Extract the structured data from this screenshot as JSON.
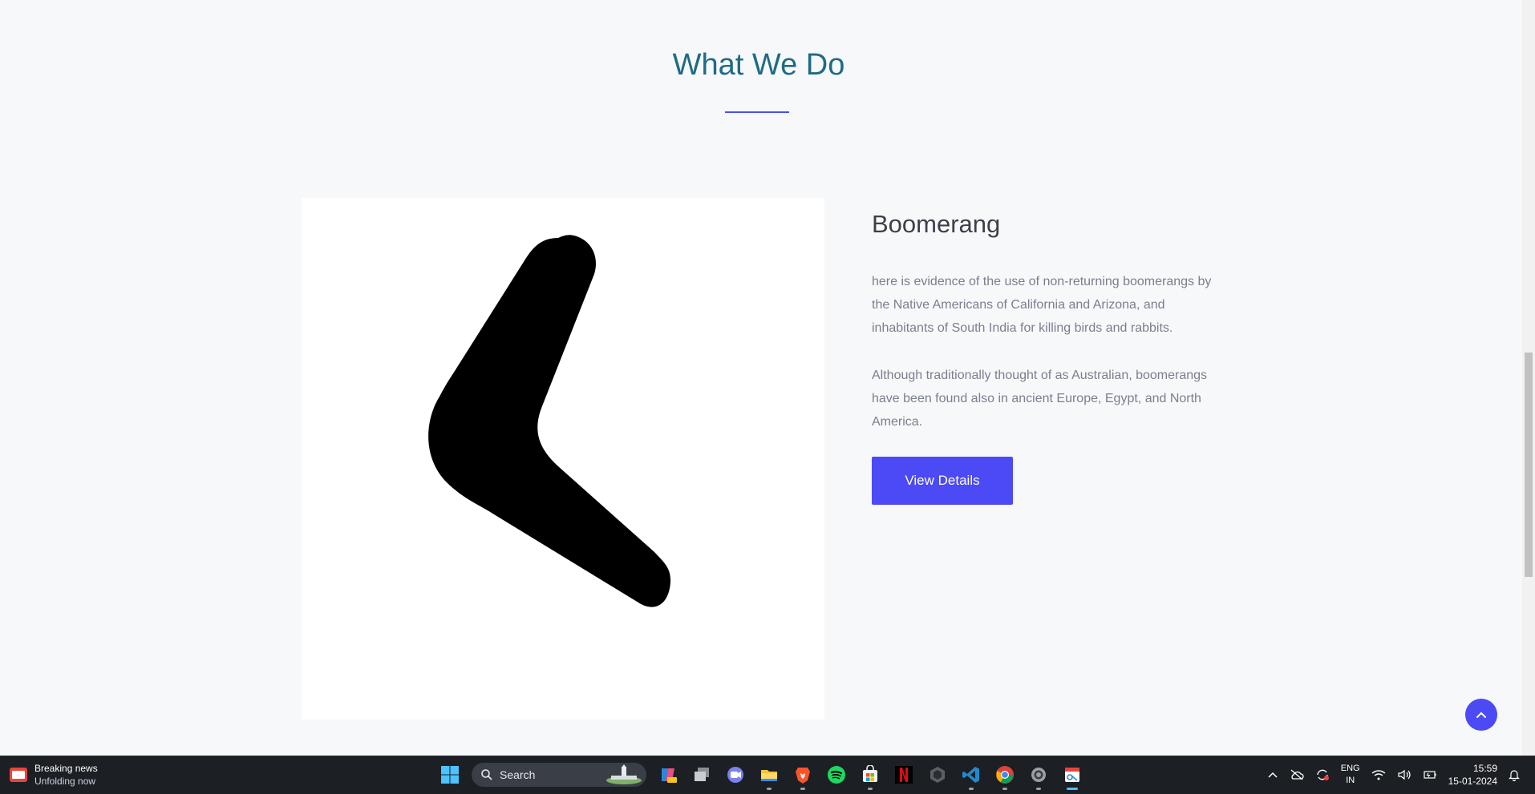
{
  "section": {
    "title": "What We Do"
  },
  "feature": {
    "heading": "Boomerang",
    "paragraph_1": "here is evidence of the use of non-returning boomerangs by the Native Americans of California and Arizona, and inhabitants of South India for killing birds and rabbits.",
    "paragraph_2": "Although traditionally thought of as Australian, boomerangs have been found also in ancient Europe, Egypt, and North America.",
    "button_label": "View Details",
    "image_icon": "boomerang-image"
  },
  "scroll_to_top": {
    "icon": "chevron-up-icon"
  },
  "taskbar": {
    "news_title": "Breaking news",
    "news_subtitle": "Unfolding now",
    "search_placeholder": "Search",
    "apps": [
      "windows-start-icon",
      "copilot-icon",
      "task-view-icon",
      "teams-chat-icon",
      "file-explorer-icon",
      "brave-icon",
      "spotify-icon",
      "microsoft-store-icon",
      "netflix-icon",
      "unity-icon",
      "vscode-icon",
      "chrome-icon",
      "settings-icon",
      "snipping-tool-icon"
    ],
    "language": "ENG",
    "region": "IN",
    "time": "15:59",
    "date": "15-01-2024"
  },
  "colors": {
    "accent": "#4b4af4",
    "title": "#1f6b85",
    "background": "#f7f8fa"
  }
}
